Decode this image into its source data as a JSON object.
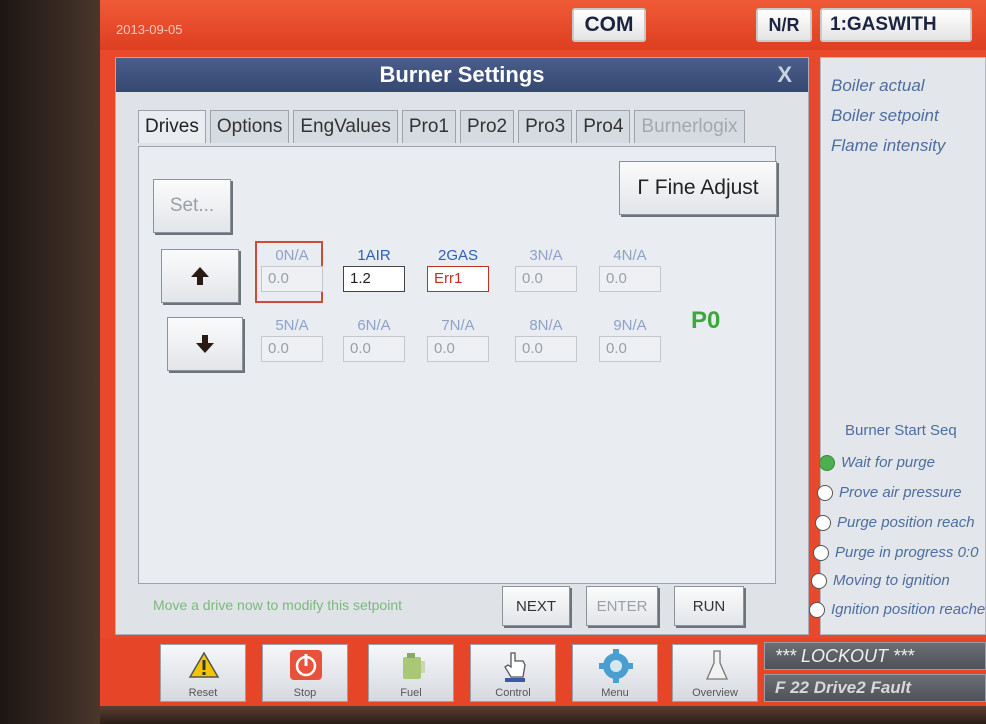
{
  "topbar": {
    "date": "2013-09-05",
    "com_label": "COM",
    "nr_label": "N/R",
    "fuel_label": "1:GASWITH"
  },
  "dialog": {
    "title": "Burner Settings",
    "close_label": "X",
    "tabs": [
      {
        "label": "Drives"
      },
      {
        "label": "Options"
      },
      {
        "label": "EngValues"
      },
      {
        "label": "Pro1"
      },
      {
        "label": "Pro2"
      },
      {
        "label": "Pro3"
      },
      {
        "label": "Pro4"
      },
      {
        "label": "Burnerlogix"
      }
    ],
    "set_label": "Set...",
    "fine_adjust_label": "Γ Fine Adjust",
    "up_icon": "up-arrow-icon",
    "down_icon": "down-arrow-icon",
    "drives": [
      {
        "label": "0N/A",
        "value": "0.0"
      },
      {
        "label": "1AIR",
        "value": "1.2"
      },
      {
        "label": "2GAS",
        "value": "Err1"
      },
      {
        "label": "3N/A",
        "value": "0.0"
      },
      {
        "label": "4N/A",
        "value": "0.0"
      },
      {
        "label": "5N/A",
        "value": "0.0"
      },
      {
        "label": "6N/A",
        "value": "0.0"
      },
      {
        "label": "7N/A",
        "value": "0.0"
      },
      {
        "label": "8N/A",
        "value": "0.0"
      },
      {
        "label": "9N/A",
        "value": "0.0"
      }
    ],
    "point_status": "P0",
    "footer_message": "Move a drive now to modify this setpoint",
    "next_label": "NEXT",
    "enter_label": "ENTER",
    "run_label": "RUN"
  },
  "right_panel": {
    "items": [
      "Boiler actual",
      "Boiler setpoint",
      "Flame intensity"
    ],
    "sequence_title": "Burner Start Seq",
    "sequence": [
      {
        "label": "Wait for purge",
        "active": true
      },
      {
        "label": "Prove air pressure",
        "active": false
      },
      {
        "label": "Purge position reach",
        "active": false
      },
      {
        "label": "Purge in progress 0:0",
        "active": false
      },
      {
        "label": "Moving to ignition",
        "active": false
      },
      {
        "label": "Ignition position reache",
        "active": false
      }
    ]
  },
  "bottom_bar": {
    "buttons": [
      {
        "label": "Reset",
        "icon": "warning-icon"
      },
      {
        "label": "Stop",
        "icon": "power-icon"
      },
      {
        "label": "Fuel",
        "icon": "fuel-can-icon"
      },
      {
        "label": "Control",
        "icon": "hand-pointer-icon"
      },
      {
        "label": "Menu",
        "icon": "gear-icon"
      },
      {
        "label": "Overview",
        "icon": "flask-icon"
      }
    ],
    "lockout_text": "*** LOCKOUT ***",
    "fault_text": "F 22  Drive2 Fault"
  },
  "colors": {
    "frame_orange": "#e8492a",
    "title_blue": "#3d5080",
    "drive_active_blue": "#2d5fb8",
    "error_red": "#c43020",
    "status_green": "#3aa83a"
  }
}
